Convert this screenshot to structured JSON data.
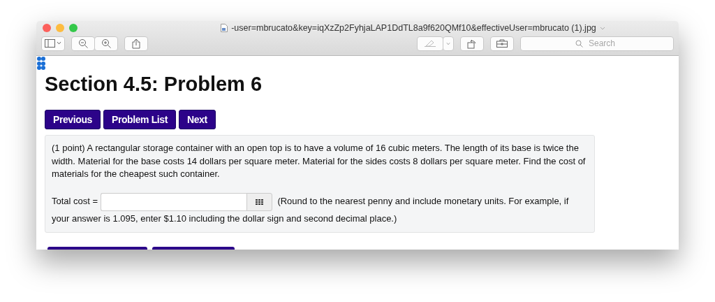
{
  "window": {
    "title": "-user=mbrucato&key=iqXzZp2FyhjaLAP1DdTL8a9f620QMf10&effectiveUser=mbrucato (1).jpg",
    "search": {
      "placeholder": "Search"
    }
  },
  "page": {
    "heading": "Section 4.5: Problem 6",
    "nav_buttons": [
      "Previous",
      "Problem List",
      "Next"
    ],
    "problem": {
      "text": "(1 point) A rectangular storage container with an open top is to have a volume of 16 cubic meters. The length of its base is twice the width. Material for the base costs 14 dollars per square meter. Material for the sides costs 8 dollars per square meter. Find the cost of materials for the cheapest such container.",
      "answer_label": "Total cost =",
      "note_lines": [
        "(Round to the nearest penny and include monetary units. For example, if",
        "your answer is 1.095, enter $1.10 including the dollar sign and second decimal place.)"
      ]
    },
    "bottom_buttons": [
      {
        "kind": "button"
      },
      {
        "kind": "button"
      }
    ]
  }
}
